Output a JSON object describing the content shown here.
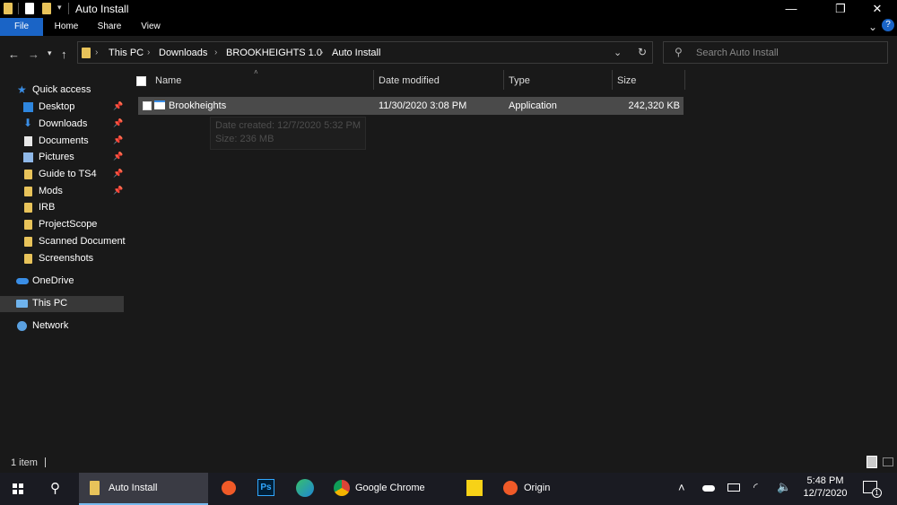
{
  "window": {
    "title": "Auto Install"
  },
  "ribbon": {
    "tabs": [
      "File",
      "Home",
      "Share",
      "View"
    ]
  },
  "address": {
    "crumbs": [
      "This PC",
      "Downloads",
      "BROOKHEIGHTS 1.0",
      "Auto Install"
    ]
  },
  "search": {
    "placeholder": "Search Auto Install"
  },
  "nav": {
    "quick_access": "Quick access",
    "items": [
      {
        "label": "Desktop",
        "icon": "desktop-icon",
        "pinned": true
      },
      {
        "label": "Downloads",
        "icon": "download-icon",
        "pinned": true
      },
      {
        "label": "Documents",
        "icon": "documents-icon",
        "pinned": true
      },
      {
        "label": "Pictures",
        "icon": "pictures-icon",
        "pinned": true
      },
      {
        "label": "Guide to TS4",
        "icon": "folder-icon",
        "pinned": true
      },
      {
        "label": "Mods",
        "icon": "folder-icon",
        "pinned": true
      },
      {
        "label": "IRB",
        "icon": "folder-icon",
        "pinned": false
      },
      {
        "label": "ProjectScope",
        "icon": "folder-icon",
        "pinned": false
      },
      {
        "label": "Scanned Documents",
        "icon": "folder-icon",
        "pinned": false
      },
      {
        "label": "Screenshots",
        "icon": "folder-icon",
        "pinned": false
      }
    ],
    "onedrive": "OneDrive",
    "thispc": "This PC",
    "network": "Network"
  },
  "columns": {
    "name": "Name",
    "date": "Date modified",
    "type": "Type",
    "size": "Size"
  },
  "file": {
    "name": "Brookheights",
    "date": "11/30/2020 3:08 PM",
    "type": "Application",
    "size": "242,320 KB"
  },
  "tooltip": {
    "created": "Date created: 12/7/2020 5:32 PM",
    "size": "Size: 236 MB"
  },
  "status": {
    "count": "1 item"
  },
  "taskbar": {
    "explorer_label": "Auto Install",
    "chrome_label": "Google Chrome",
    "origin_label": "Origin",
    "time": "5:48 PM",
    "date": "12/7/2020",
    "notifications": "1"
  },
  "colors": {
    "accent": "#1a64c6",
    "selection": "#4a4a4a",
    "folder": "#e8c35a"
  }
}
